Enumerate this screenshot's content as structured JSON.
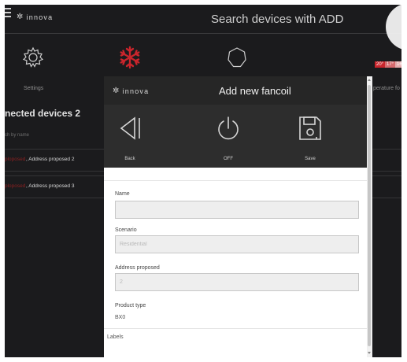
{
  "header": {
    "logo_text": "innova",
    "title": "Search devices with ADD"
  },
  "background": {
    "icons": [
      {
        "name": "settings",
        "label": "Settings",
        "icon": "gear-icon"
      },
      {
        "name": "cooling",
        "label": "",
        "icon": "snowflake-icon"
      },
      {
        "name": "power",
        "label": "",
        "icon": "power-icon"
      }
    ],
    "temperature_label": "perature fo",
    "temp_badges": [
      "20°",
      "17°",
      "16"
    ],
    "connected_title": "nected devices 2",
    "search_placeholder": "ch by name",
    "devices": [
      {
        "status": "ploposed",
        "address": ", Address proposed 2"
      },
      {
        "status": "ploposed",
        "address": ", Address proposed 3"
      }
    ]
  },
  "modal": {
    "logo_text": "innova",
    "title": "Add new fancoil",
    "toolbar": [
      {
        "label": "Back",
        "icon": "back-icon"
      },
      {
        "label": "OFF",
        "icon": "power-icon"
      },
      {
        "label": "Save",
        "icon": "save-icon"
      }
    ],
    "form": {
      "name": {
        "label": "Name",
        "value": ""
      },
      "scenario": {
        "label": "Scenario",
        "placeholder": "Residential"
      },
      "address": {
        "label": "Address proposed",
        "placeholder": "2"
      },
      "product_type": {
        "label": "Product type",
        "value": "BX0"
      },
      "labels_heading": "Labels"
    }
  },
  "colors": {
    "background": "#1b1b1d",
    "modal_header": "#262626",
    "toolbar": "#2d2d2d",
    "accent_red": "#c9252c",
    "input_bg": "#eeeeee"
  }
}
